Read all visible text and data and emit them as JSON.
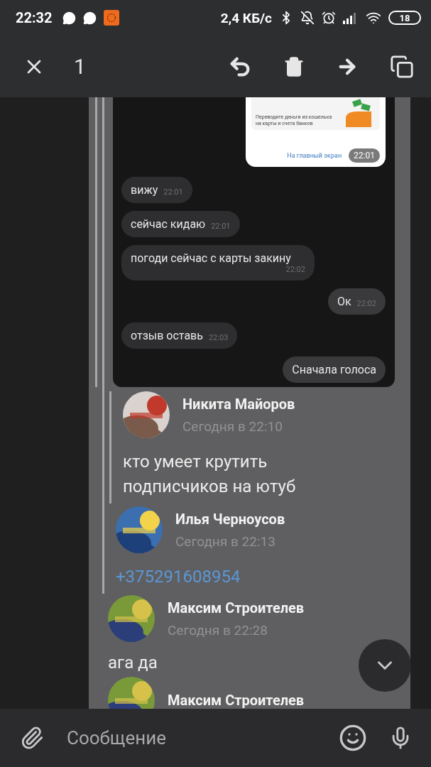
{
  "status_bar": {
    "time": "22:32",
    "speed": "2,4 КБ/с",
    "battery": "18"
  },
  "selection_bar": {
    "count": "1"
  },
  "forwarded": {
    "screenshot": {
      "card_text": "Переводите деньги из кошелька на карты и счета банков",
      "card_link": "На главный экран",
      "card_time": "22:01",
      "bubbles": [
        {
          "text": "вижу",
          "time": "22:01",
          "outgoing": false
        },
        {
          "text": "сейчас кидаю",
          "time": "22:01",
          "outgoing": false
        },
        {
          "text": "погоди сейчас с карты закину",
          "time": "22:02",
          "outgoing": false
        },
        {
          "text": "Ок",
          "time": "22:02",
          "outgoing": true
        },
        {
          "text": "отзыв оставь",
          "time": "22:03",
          "outgoing": false
        },
        {
          "text": "Сначала голоса",
          "outgoing": true
        }
      ]
    },
    "posts": [
      {
        "kind": "text",
        "author": "Никита Майоров",
        "date": "Сегодня в 22:10",
        "text": "кто умеет крутить подписчиков на ютуб"
      },
      {
        "kind": "phone",
        "author": "Илья Черноусов",
        "date": "Сегодня в 22:13",
        "text": "+375291608954"
      }
    ]
  },
  "messages": [
    {
      "author": "Максим Строителев",
      "date": "Сегодня в 22:28",
      "text": "ага да"
    },
    {
      "author": "Максим Строителев"
    }
  ],
  "composer": {
    "placeholder": "Сообщение"
  }
}
